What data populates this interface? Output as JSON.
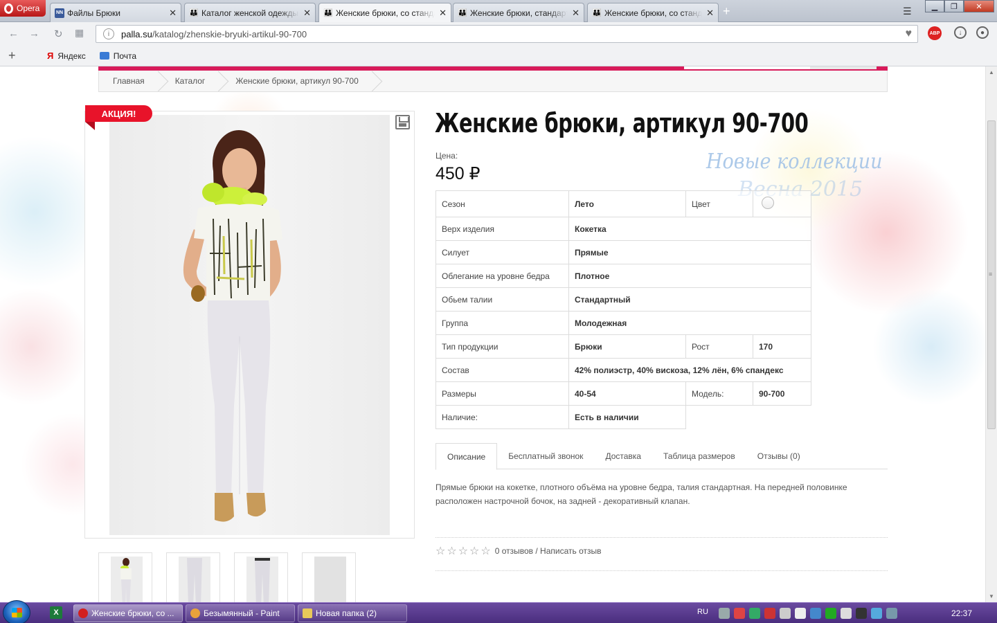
{
  "browser": {
    "menu_label": "Opera",
    "tabs": [
      {
        "icon": "nn-icon",
        "title": "Файлы Брюки"
      },
      {
        "icon": "site-icon",
        "title": "Каталог женской одежды"
      },
      {
        "icon": "site-icon",
        "title": "Женские брюки, со стандартной"
      },
      {
        "icon": "site-icon",
        "title": "Женские брюки, стандарт"
      },
      {
        "icon": "site-icon",
        "title": "Женские брюки, со станд"
      }
    ],
    "active_tab": 2,
    "url_host": "palla.su",
    "url_path": "/katalog/zhenskie-bryuki-artikul-90-700",
    "abp_label": "ABP",
    "bookmarks": [
      {
        "label": "Яндекс"
      },
      {
        "label": "Почта"
      }
    ]
  },
  "page": {
    "breadcrumb": [
      "Главная",
      "Каталог",
      "Женские брюки, артикул 90-700"
    ],
    "badge": "АКЦИЯ!",
    "product_title": "Женские брюки, артикул 90-700",
    "watermark_line1": "Новые коллекции",
    "watermark_line2": "Весна 2015",
    "price_label": "Цена:",
    "price": "450 ₽",
    "specs": {
      "season_label": "Сезон",
      "season": "Лето",
      "color_label": "Цвет",
      "top_label": "Верх изделия",
      "top": "Кокетка",
      "silhouette_label": "Силует",
      "silhouette": "Прямые",
      "fit_label": "Облегание на уровне бедра",
      "fit": "Плотное",
      "waist_label": "Обьем талии",
      "waist": "Стандартный",
      "group_label": "Группа",
      "group": "Молодежная",
      "type_label": "Тип продукции",
      "type": "Брюки",
      "height_label": "Рост",
      "height": "170",
      "composition_label": "Состав",
      "composition": "42% полиэстр, 40% вискоза, 12% лён, 6% спандекс",
      "sizes_label": "Размеры",
      "sizes": "40-54",
      "model_label": "Модель:",
      "model": "90-700",
      "stock_label": "Наличие:",
      "stock": "Есть в наличии"
    },
    "tabs": [
      "Описание",
      "Бесплатный звонок",
      "Доставка",
      "Таблица размеров",
      "Отзывы (0)"
    ],
    "description": "Прямые брюки на кокетке, плотного объёма на уровне бедра, талия стандартная. На передней половинке расположен настрочной бочок, на задней - декоративный клапан.",
    "reviews_text": "0 отзывов / Написать отзыв",
    "rating": 0
  },
  "taskbar": {
    "buttons": [
      "Женские брюки, со ...",
      "Безымянный - Paint",
      "Новая папка (2)"
    ],
    "lang": "RU",
    "clock": "22:37"
  },
  "colors": {
    "accent": "#d81b5a",
    "badge": "#e8132a",
    "taskbar": "#4a2e7e"
  }
}
